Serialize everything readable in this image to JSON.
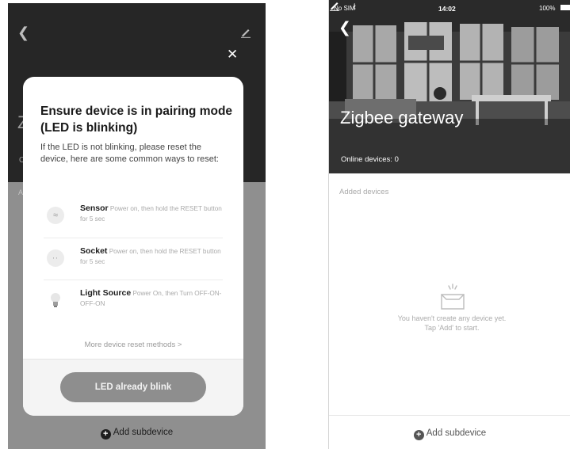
{
  "left_screen": {
    "header": {
      "back_icon": "chevron-left-icon",
      "edit_icon": "pencil-icon",
      "peek_title": "Z",
      "peek_online": "O",
      "peek_added": "A"
    },
    "close_icon": "close-icon",
    "modal": {
      "title": "Ensure device is in pairing mode (LED is blinking)",
      "description": "If the LED is not blinking, please reset the device, here are some common ways to reset:",
      "reset_items": [
        {
          "name": "Sensor",
          "text": "Power on, then hold the RESET button for 5 sec",
          "icon": "sensor-icon"
        },
        {
          "name": "Socket",
          "text": "Power on, then hold the RESET button for 5 sec",
          "icon": "socket-icon"
        },
        {
          "name": "Light Source",
          "text": "Power On, then Turn OFF-ON-OFF-ON",
          "icon": "bulb-icon"
        }
      ],
      "more_link": "More device reset methods >",
      "confirm_button": "LED already blink"
    },
    "add_subdevice": "Add subdevice"
  },
  "right_screen": {
    "status_bar": {
      "carrier": "No SIM",
      "time": "14:02",
      "battery": "100%"
    },
    "header": {
      "back_icon": "chevron-left-icon",
      "edit_icon": "pencil-icon",
      "title": "Zigbee gateway",
      "online_devices": "Online devices: 0"
    },
    "added_devices_label": "Added devices",
    "empty_state": {
      "icon": "empty-box-icon",
      "line1": "You haven't create any device yet.",
      "line2": "Tap 'Add' to start."
    },
    "add_subdevice": "Add subdevice"
  }
}
